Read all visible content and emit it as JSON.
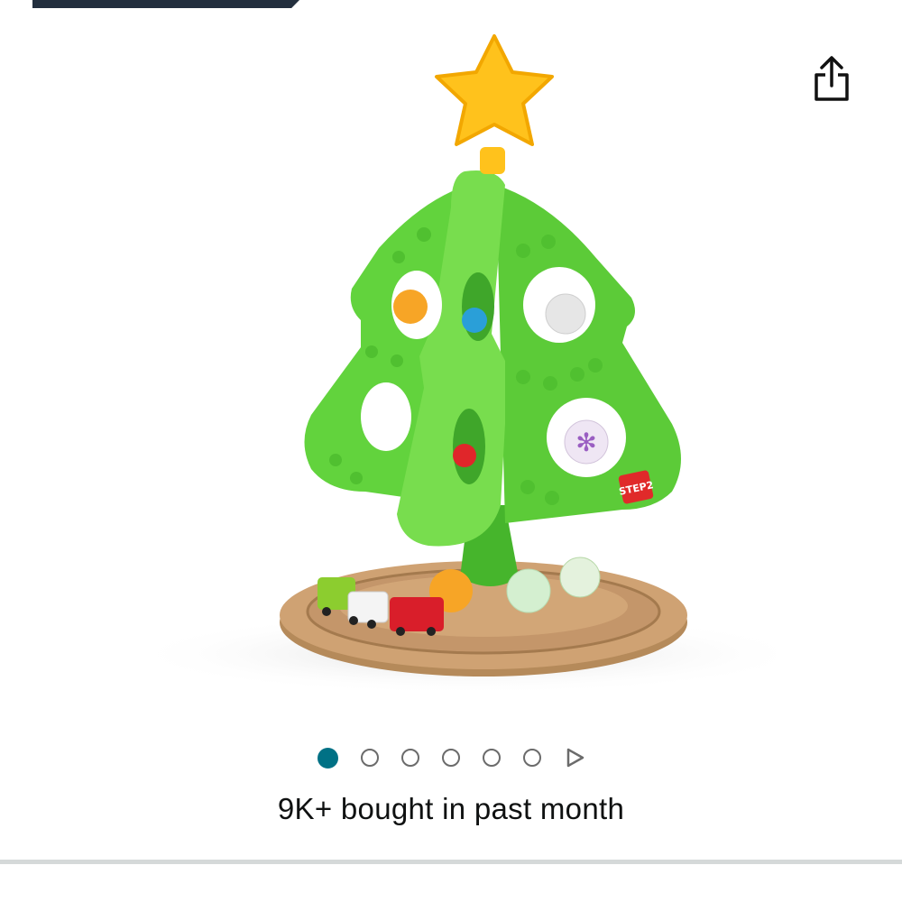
{
  "header": {
    "banner_color": "#232f3e"
  },
  "share": {
    "icon": "share-icon"
  },
  "product": {
    "image_alt": "",
    "colors": {
      "tree": "#5dce3a",
      "star": "#ffc21c",
      "base": "#c69a6a"
    }
  },
  "carousel": {
    "total_images": 6,
    "active_index": 0,
    "active_color": "#007185",
    "next_icon": "play-triangle-icon"
  },
  "social_proof": {
    "text": "9K+ bought in past month"
  }
}
